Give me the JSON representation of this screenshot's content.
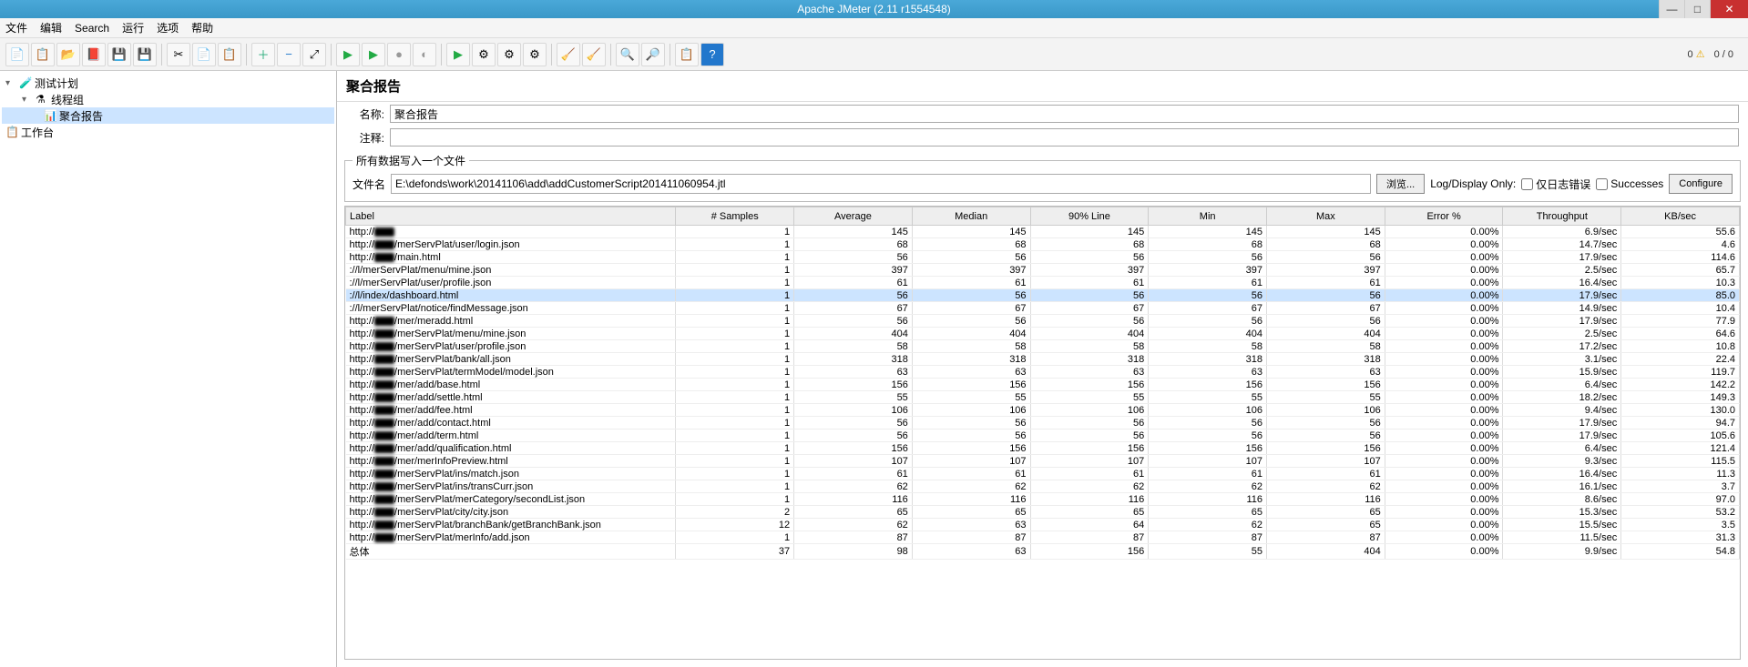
{
  "window": {
    "title": "Apache JMeter (2.11 r1554548)",
    "status_left": "0",
    "status_right": "0 / 0"
  },
  "menu": [
    "文件",
    "编辑",
    "Search",
    "运行",
    "选项",
    "帮助"
  ],
  "tree": {
    "root": "测试计划",
    "group": "线程组",
    "report": "聚合报告",
    "workbench": "工作台"
  },
  "panel": {
    "title": "聚合报告",
    "name_label": "名称:",
    "name_value": "聚合报告",
    "comment_label": "注释:",
    "comment_value": "",
    "file_legend": "所有数据写入一个文件",
    "file_label": "文件名",
    "file_value": "E:\\defonds\\work\\20141106\\add\\addCustomerScript201411060954.jtl",
    "browse": "浏览...",
    "display_only": "Log/Display Only:",
    "cb_errors": "仅日志错误",
    "cb_success": "Successes",
    "configure": "Configure"
  },
  "columns": [
    "Label",
    "# Samples",
    "Average",
    "Median",
    "90% Line",
    "Min",
    "Max",
    "Error %",
    "Throughput",
    "KB/sec"
  ],
  "chart_data": {
    "type": "table",
    "columns": [
      "Label",
      "# Samples",
      "Average",
      "Median",
      "90% Line",
      "Min",
      "Max",
      "Error %",
      "Throughput",
      "KB/sec"
    ],
    "rows": [
      [
        "http://███████",
        "1",
        "145",
        "145",
        "145",
        "145",
        "145",
        "0.00%",
        "6.9/sec",
        "55.6"
      ],
      [
        "http://███/merServPlat/user/login.json",
        "1",
        "68",
        "68",
        "68",
        "68",
        "68",
        "0.00%",
        "14.7/sec",
        "4.6"
      ],
      [
        "http://███/main.html",
        "1",
        "56",
        "56",
        "56",
        "56",
        "56",
        "0.00%",
        "17.9/sec",
        "114.6"
      ],
      [
        "://l/merServPlat/menu/mine.json",
        "1",
        "397",
        "397",
        "397",
        "397",
        "397",
        "0.00%",
        "2.5/sec",
        "65.7"
      ],
      [
        "://l/merServPlat/user/profile.json",
        "1",
        "61",
        "61",
        "61",
        "61",
        "61",
        "0.00%",
        "16.4/sec",
        "10.3"
      ],
      [
        "://l/index/dashboard.html",
        "1",
        "56",
        "56",
        "56",
        "56",
        "56",
        "0.00%",
        "17.9/sec",
        "85.0"
      ],
      [
        "://l/merServPlat/notice/findMessage.json",
        "1",
        "67",
        "67",
        "67",
        "67",
        "67",
        "0.00%",
        "14.9/sec",
        "10.4"
      ],
      [
        "http://███/mer/meradd.html",
        "1",
        "56",
        "56",
        "56",
        "56",
        "56",
        "0.00%",
        "17.9/sec",
        "77.9"
      ],
      [
        "http://███/merServPlat/menu/mine.json",
        "1",
        "404",
        "404",
        "404",
        "404",
        "404",
        "0.00%",
        "2.5/sec",
        "64.6"
      ],
      [
        "http://███/merServPlat/user/profile.json",
        "1",
        "58",
        "58",
        "58",
        "58",
        "58",
        "0.00%",
        "17.2/sec",
        "10.8"
      ],
      [
        "http://███/merServPlat/bank/all.json",
        "1",
        "318",
        "318",
        "318",
        "318",
        "318",
        "0.00%",
        "3.1/sec",
        "22.4"
      ],
      [
        "http://███/merServPlat/termModel/model.json",
        "1",
        "63",
        "63",
        "63",
        "63",
        "63",
        "0.00%",
        "15.9/sec",
        "119.7"
      ],
      [
        "http://███/mer/add/base.html",
        "1",
        "156",
        "156",
        "156",
        "156",
        "156",
        "0.00%",
        "6.4/sec",
        "142.2"
      ],
      [
        "http://███/mer/add/settle.html",
        "1",
        "55",
        "55",
        "55",
        "55",
        "55",
        "0.00%",
        "18.2/sec",
        "149.3"
      ],
      [
        "http://███/mer/add/fee.html",
        "1",
        "106",
        "106",
        "106",
        "106",
        "106",
        "0.00%",
        "9.4/sec",
        "130.0"
      ],
      [
        "http://███/mer/add/contact.html",
        "1",
        "56",
        "56",
        "56",
        "56",
        "56",
        "0.00%",
        "17.9/sec",
        "94.7"
      ],
      [
        "http://███/mer/add/term.html",
        "1",
        "56",
        "56",
        "56",
        "56",
        "56",
        "0.00%",
        "17.9/sec",
        "105.6"
      ],
      [
        "http://███/mer/add/qualification.html",
        "1",
        "156",
        "156",
        "156",
        "156",
        "156",
        "0.00%",
        "6.4/sec",
        "121.4"
      ],
      [
        "http://███/mer/merInfoPreview.html",
        "1",
        "107",
        "107",
        "107",
        "107",
        "107",
        "0.00%",
        "9.3/sec",
        "115.5"
      ],
      [
        "http://███/merServPlat/ins/match.json",
        "1",
        "61",
        "61",
        "61",
        "61",
        "61",
        "0.00%",
        "16.4/sec",
        "11.3"
      ],
      [
        "http://███/merServPlat/ins/transCurr.json",
        "1",
        "62",
        "62",
        "62",
        "62",
        "62",
        "0.00%",
        "16.1/sec",
        "3.7"
      ],
      [
        "http://███/merServPlat/merCategory/secondList.json",
        "1",
        "116",
        "116",
        "116",
        "116",
        "116",
        "0.00%",
        "8.6/sec",
        "97.0"
      ],
      [
        "http://███/merServPlat/city/city.json",
        "2",
        "65",
        "65",
        "65",
        "65",
        "65",
        "0.00%",
        "15.3/sec",
        "53.2"
      ],
      [
        "http://███/merServPlat/branchBank/getBranchBank.json",
        "12",
        "62",
        "63",
        "64",
        "62",
        "65",
        "0.00%",
        "15.5/sec",
        "3.5"
      ],
      [
        "http://███/merServPlat/merInfo/add.json",
        "1",
        "87",
        "87",
        "87",
        "87",
        "87",
        "0.00%",
        "11.5/sec",
        "31.3"
      ],
      [
        "总体",
        "37",
        "98",
        "63",
        "156",
        "55",
        "404",
        "0.00%",
        "9.9/sec",
        "54.8"
      ]
    ],
    "selected_row": 5
  }
}
